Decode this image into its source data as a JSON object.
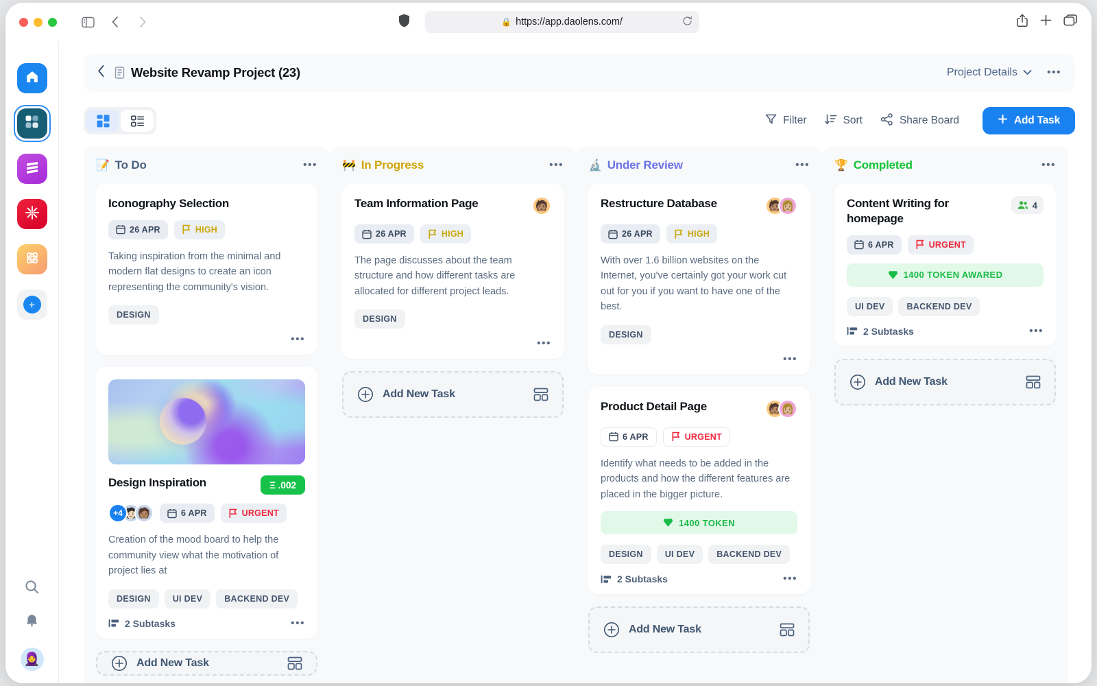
{
  "browser": {
    "url": "https://app.daolens.com/",
    "lock_icon": "lock-icon",
    "shield_icon": "shield-icon",
    "reload_icon": "reload-icon",
    "sidebar_toggle_icon": "sidebar-toggle-icon",
    "back_icon": "back-arrow-icon",
    "forward_icon": "forward-arrow-icon",
    "share_icon": "share-icon",
    "new_tab_icon": "plus-icon",
    "tabs_icon": "tabs-overview-icon"
  },
  "rail": {
    "apps": [
      {
        "name": "home",
        "icon": "home-icon"
      },
      {
        "name": "board",
        "icon": "grid-icon",
        "selected": true
      },
      {
        "name": "layers",
        "icon": "layers-icon"
      },
      {
        "name": "burst",
        "icon": "burst-icon"
      },
      {
        "name": "atom",
        "icon": "atom-icon"
      },
      {
        "name": "add-workspace",
        "icon": "plus-icon"
      }
    ],
    "bottom": [
      {
        "name": "search",
        "icon": "search-icon"
      },
      {
        "name": "notifications",
        "icon": "bell-icon"
      },
      {
        "name": "profile",
        "icon": "avatar",
        "emoji": "🧕"
      }
    ]
  },
  "header": {
    "back_icon": "chevron-left-icon",
    "doc_icon": "document-icon",
    "title": "Website Revamp Project (23)",
    "details_label": "Project Details",
    "chevron_icon": "chevron-down-icon",
    "more_icon": "ellipsis-icon"
  },
  "toolbar": {
    "view_board_icon": "board-view-icon",
    "view_list_icon": "list-view-icon",
    "filter_label": "Filter",
    "filter_icon": "funnel-icon",
    "sort_label": "Sort",
    "sort_icon": "sort-icon",
    "share_label": "Share Board",
    "share_icon": "share-nodes-icon",
    "add_task_label": "Add Task",
    "add_task_icon": "plus-icon",
    "accent_color": "#1a82f0"
  },
  "add_new_task_label": "Add New Task",
  "columns": [
    {
      "id": "todo",
      "emoji": "📝",
      "title": "To Do",
      "color": "#4a6180",
      "more_icon": "ellipsis-icon",
      "cards": [
        {
          "title": "Iconography Selection",
          "date": "26 APR",
          "priority": "HIGH",
          "priority_kind": "high",
          "description": "Taking inspiration from the minimal and modern flat designs to create an icon representing the community's vision.",
          "tags": [
            "DESIGN"
          ],
          "more_icon": "ellipsis-icon"
        },
        {
          "title": "Design Inspiration",
          "image": "abstract-gradient-spheres",
          "eth_badge": "Ξ .002",
          "avatar_count": "+4",
          "date": "6 APR",
          "priority": "URGENT",
          "priority_kind": "urgent",
          "description": "Creation of the mood board to help the community view what the motivation of project lies at",
          "tags": [
            "DESIGN",
            "UI DEV",
            "BACKEND DEV"
          ],
          "subtasks": "2 Subtasks",
          "more_icon": "ellipsis-icon"
        }
      ],
      "has_add_new": true,
      "add_new_clipped": true
    },
    {
      "id": "in-progress",
      "emoji": "🚧",
      "title": "In Progress",
      "color": "#cda607",
      "more_icon": "ellipsis-icon",
      "cards": [
        {
          "title": "Team Information Page",
          "avatars": [
            "a1"
          ],
          "date": "26 APR",
          "priority": "HIGH",
          "priority_kind": "high",
          "description": "The page discusses about the team structure and how different tasks are allocated for different project leads.",
          "tags": [
            "DESIGN"
          ],
          "more_icon": "ellipsis-icon"
        }
      ],
      "has_add_new": true
    },
    {
      "id": "under-review",
      "emoji": "🔬",
      "title": "Under Review",
      "color": "#6a72e8",
      "more_icon": "ellipsis-icon",
      "cards": [
        {
          "title": "Restructure Database",
          "avatars": [
            "a1",
            "a2"
          ],
          "date": "26 APR",
          "priority": "HIGH",
          "priority_kind": "high",
          "description": "With over 1.6 billion websites on the Internet, you've certainly got your work cut out for you if you want to have one of the best.",
          "tags": [
            "DESIGN"
          ],
          "more_icon": "ellipsis-icon"
        },
        {
          "title": "Product Detail Page",
          "avatars": [
            "a1",
            "a2"
          ],
          "date": "6 APR",
          "chip_style": "white",
          "priority": "URGENT",
          "priority_kind": "urgent",
          "description": "Identify what needs to be added in the products and how the different features are placed in the bigger picture.",
          "token": "1400 TOKEN",
          "token_icon": "gem-icon",
          "tags": [
            "DESIGN",
            "UI DEV",
            "BACKEND DEV"
          ],
          "subtasks": "2 Subtasks",
          "more_icon": "ellipsis-icon"
        }
      ],
      "has_add_new": true
    },
    {
      "id": "completed",
      "emoji": "🏆",
      "title": "Completed",
      "color": "#12c437",
      "more_icon": "ellipsis-icon",
      "cards": [
        {
          "title": "Content Writing for homepage",
          "members_count": "4",
          "members_icon": "people-icon",
          "date": "6 APR",
          "priority": "URGENT",
          "priority_kind": "urgent",
          "token": "1400 TOKEN AWARED",
          "token_icon": "gem-icon",
          "tags": [
            "UI DEV",
            "BACKEND DEV"
          ],
          "subtasks": "2 Subtasks",
          "more_icon": "ellipsis-icon"
        }
      ],
      "has_add_new": true
    }
  ]
}
